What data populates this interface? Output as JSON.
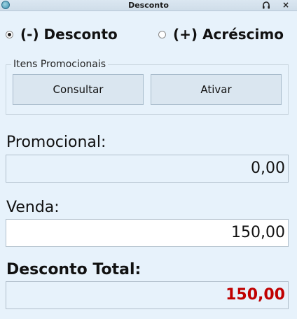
{
  "window": {
    "title": "Desconto",
    "headset_glyph": "🎧",
    "close_glyph": "×"
  },
  "mode": {
    "desconto_label": "(-) Desconto",
    "acrescimo_label": "(+) Acréscimo",
    "selected": "desconto"
  },
  "promo_group": {
    "legend": "Itens Promocionais",
    "consultar_label": "Consultar",
    "ativar_label": "Ativar"
  },
  "fields": {
    "promocional_label": "Promocional:",
    "promocional_value": "0,00",
    "venda_label": "Venda:",
    "venda_value": "150,00",
    "total_label": "Desconto Total:",
    "total_value": "150,00"
  },
  "colors": {
    "background": "#e7f2fb",
    "total_value": "#c00000"
  }
}
